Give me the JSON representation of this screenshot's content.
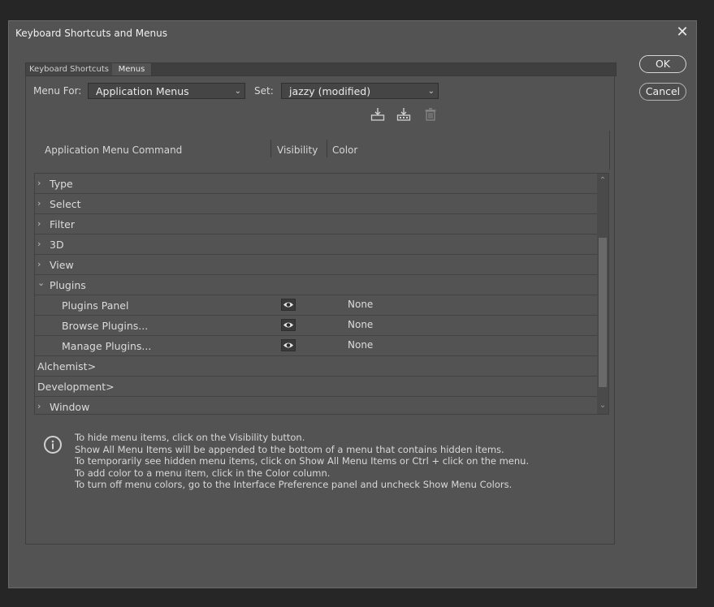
{
  "dialog": {
    "title": "Keyboard Shortcuts and Menus",
    "close_icon": "close-icon"
  },
  "tabs": [
    {
      "label": "Keyboard Shortcuts",
      "active": false
    },
    {
      "label": "Menus",
      "active": true
    }
  ],
  "controls": {
    "menu_for_label": "Menu For:",
    "menu_for_value": "Application Menus",
    "set_label": "Set:",
    "set_value": "jazzy (modified)",
    "icons": [
      "save-set-icon",
      "save-set-as-icon",
      "delete-set-icon"
    ]
  },
  "table": {
    "headers": {
      "command": "Application Menu Command",
      "visibility": "Visibility",
      "color": "Color"
    },
    "rows": [
      {
        "label": "Type",
        "expander": "collapsed"
      },
      {
        "label": "Select",
        "expander": "collapsed"
      },
      {
        "label": "Filter",
        "expander": "collapsed"
      },
      {
        "label": "3D",
        "expander": "collapsed"
      },
      {
        "label": "View",
        "expander": "collapsed"
      },
      {
        "label": "Plugins",
        "expander": "expanded"
      },
      {
        "label": "Plugins Panel",
        "child": true,
        "visible": true,
        "color": "None"
      },
      {
        "label": "Browse Plugins...",
        "child": true,
        "visible": true,
        "color": "None"
      },
      {
        "label": "Manage Plugins...",
        "child": true,
        "visible": true,
        "color": "None"
      },
      {
        "label": "Alchemist>",
        "expander": "none"
      },
      {
        "label": "Development>",
        "expander": "none"
      },
      {
        "label": "Window",
        "expander": "collapsed"
      }
    ]
  },
  "info": {
    "icon": "info-icon",
    "lines": [
      "To hide menu items, click on the Visibility button.",
      "Show All Menu Items will be appended to the bottom of a menu that contains hidden items.",
      "To temporarily see hidden menu items, click on Show All Menu Items or Ctrl + click on the menu.",
      "To add color to a menu item, click in the Color column.",
      "To turn off menu colors, go to the Interface Preference panel and uncheck Show Menu Colors."
    ]
  },
  "buttons": {
    "ok": "OK",
    "cancel": "Cancel"
  }
}
